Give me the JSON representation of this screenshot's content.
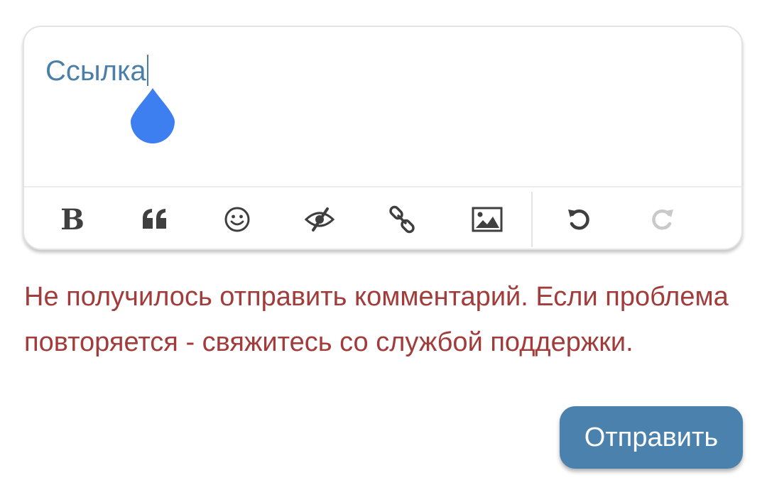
{
  "editor": {
    "value": "Ссылка",
    "caret_color": "#4a7fa8",
    "handle_color": "#3d7ef0"
  },
  "toolbar": {
    "buttons": [
      {
        "name": "bold",
        "icon": "bold-icon",
        "glyph": "B"
      },
      {
        "name": "quote",
        "icon": "quote-icon"
      },
      {
        "name": "emoji",
        "icon": "smiley-icon"
      },
      {
        "name": "spoiler",
        "icon": "eye-slash-icon"
      },
      {
        "name": "link",
        "icon": "link-icon"
      },
      {
        "name": "image",
        "icon": "image-icon"
      },
      {
        "name": "undo",
        "icon": "undo-icon"
      },
      {
        "name": "redo",
        "icon": "redo-icon",
        "disabled": true
      }
    ]
  },
  "error": {
    "message": "Не получилось отправить комментарий. Если проблема повторяется - свяжитесь со службой поддержки.",
    "color": "#a23c3a"
  },
  "submit": {
    "label": "Отправить",
    "color": "#4a81ad"
  }
}
